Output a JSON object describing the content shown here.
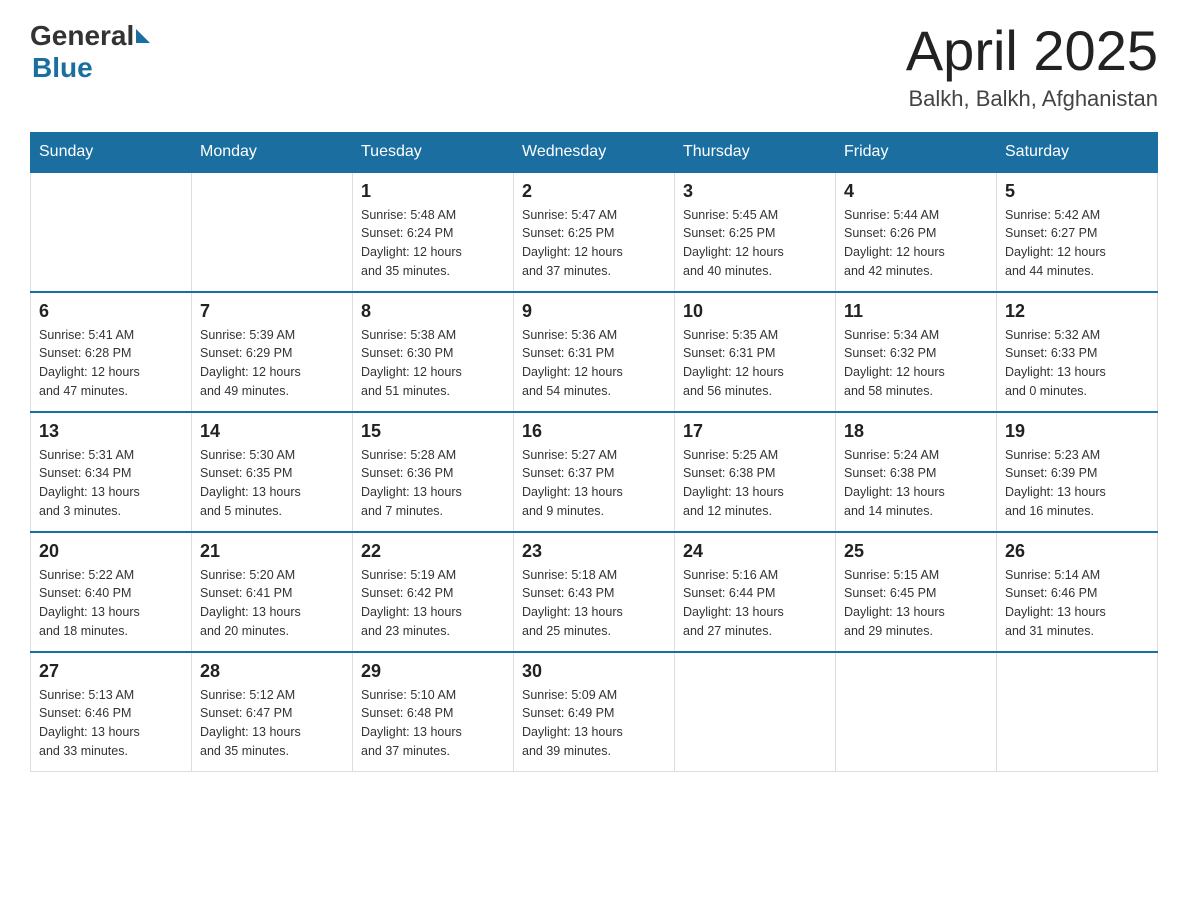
{
  "header": {
    "logo_general": "General",
    "logo_blue": "Blue",
    "month_title": "April 2025",
    "location": "Balkh, Balkh, Afghanistan"
  },
  "days_of_week": [
    "Sunday",
    "Monday",
    "Tuesday",
    "Wednesday",
    "Thursday",
    "Friday",
    "Saturday"
  ],
  "weeks": [
    [
      {
        "day": "",
        "info": ""
      },
      {
        "day": "",
        "info": ""
      },
      {
        "day": "1",
        "info": "Sunrise: 5:48 AM\nSunset: 6:24 PM\nDaylight: 12 hours\nand 35 minutes."
      },
      {
        "day": "2",
        "info": "Sunrise: 5:47 AM\nSunset: 6:25 PM\nDaylight: 12 hours\nand 37 minutes."
      },
      {
        "day": "3",
        "info": "Sunrise: 5:45 AM\nSunset: 6:25 PM\nDaylight: 12 hours\nand 40 minutes."
      },
      {
        "day": "4",
        "info": "Sunrise: 5:44 AM\nSunset: 6:26 PM\nDaylight: 12 hours\nand 42 minutes."
      },
      {
        "day": "5",
        "info": "Sunrise: 5:42 AM\nSunset: 6:27 PM\nDaylight: 12 hours\nand 44 minutes."
      }
    ],
    [
      {
        "day": "6",
        "info": "Sunrise: 5:41 AM\nSunset: 6:28 PM\nDaylight: 12 hours\nand 47 minutes."
      },
      {
        "day": "7",
        "info": "Sunrise: 5:39 AM\nSunset: 6:29 PM\nDaylight: 12 hours\nand 49 minutes."
      },
      {
        "day": "8",
        "info": "Sunrise: 5:38 AM\nSunset: 6:30 PM\nDaylight: 12 hours\nand 51 minutes."
      },
      {
        "day": "9",
        "info": "Sunrise: 5:36 AM\nSunset: 6:31 PM\nDaylight: 12 hours\nand 54 minutes."
      },
      {
        "day": "10",
        "info": "Sunrise: 5:35 AM\nSunset: 6:31 PM\nDaylight: 12 hours\nand 56 minutes."
      },
      {
        "day": "11",
        "info": "Sunrise: 5:34 AM\nSunset: 6:32 PM\nDaylight: 12 hours\nand 58 minutes."
      },
      {
        "day": "12",
        "info": "Sunrise: 5:32 AM\nSunset: 6:33 PM\nDaylight: 13 hours\nand 0 minutes."
      }
    ],
    [
      {
        "day": "13",
        "info": "Sunrise: 5:31 AM\nSunset: 6:34 PM\nDaylight: 13 hours\nand 3 minutes."
      },
      {
        "day": "14",
        "info": "Sunrise: 5:30 AM\nSunset: 6:35 PM\nDaylight: 13 hours\nand 5 minutes."
      },
      {
        "day": "15",
        "info": "Sunrise: 5:28 AM\nSunset: 6:36 PM\nDaylight: 13 hours\nand 7 minutes."
      },
      {
        "day": "16",
        "info": "Sunrise: 5:27 AM\nSunset: 6:37 PM\nDaylight: 13 hours\nand 9 minutes."
      },
      {
        "day": "17",
        "info": "Sunrise: 5:25 AM\nSunset: 6:38 PM\nDaylight: 13 hours\nand 12 minutes."
      },
      {
        "day": "18",
        "info": "Sunrise: 5:24 AM\nSunset: 6:38 PM\nDaylight: 13 hours\nand 14 minutes."
      },
      {
        "day": "19",
        "info": "Sunrise: 5:23 AM\nSunset: 6:39 PM\nDaylight: 13 hours\nand 16 minutes."
      }
    ],
    [
      {
        "day": "20",
        "info": "Sunrise: 5:22 AM\nSunset: 6:40 PM\nDaylight: 13 hours\nand 18 minutes."
      },
      {
        "day": "21",
        "info": "Sunrise: 5:20 AM\nSunset: 6:41 PM\nDaylight: 13 hours\nand 20 minutes."
      },
      {
        "day": "22",
        "info": "Sunrise: 5:19 AM\nSunset: 6:42 PM\nDaylight: 13 hours\nand 23 minutes."
      },
      {
        "day": "23",
        "info": "Sunrise: 5:18 AM\nSunset: 6:43 PM\nDaylight: 13 hours\nand 25 minutes."
      },
      {
        "day": "24",
        "info": "Sunrise: 5:16 AM\nSunset: 6:44 PM\nDaylight: 13 hours\nand 27 minutes."
      },
      {
        "day": "25",
        "info": "Sunrise: 5:15 AM\nSunset: 6:45 PM\nDaylight: 13 hours\nand 29 minutes."
      },
      {
        "day": "26",
        "info": "Sunrise: 5:14 AM\nSunset: 6:46 PM\nDaylight: 13 hours\nand 31 minutes."
      }
    ],
    [
      {
        "day": "27",
        "info": "Sunrise: 5:13 AM\nSunset: 6:46 PM\nDaylight: 13 hours\nand 33 minutes."
      },
      {
        "day": "28",
        "info": "Sunrise: 5:12 AM\nSunset: 6:47 PM\nDaylight: 13 hours\nand 35 minutes."
      },
      {
        "day": "29",
        "info": "Sunrise: 5:10 AM\nSunset: 6:48 PM\nDaylight: 13 hours\nand 37 minutes."
      },
      {
        "day": "30",
        "info": "Sunrise: 5:09 AM\nSunset: 6:49 PM\nDaylight: 13 hours\nand 39 minutes."
      },
      {
        "day": "",
        "info": ""
      },
      {
        "day": "",
        "info": ""
      },
      {
        "day": "",
        "info": ""
      }
    ]
  ]
}
